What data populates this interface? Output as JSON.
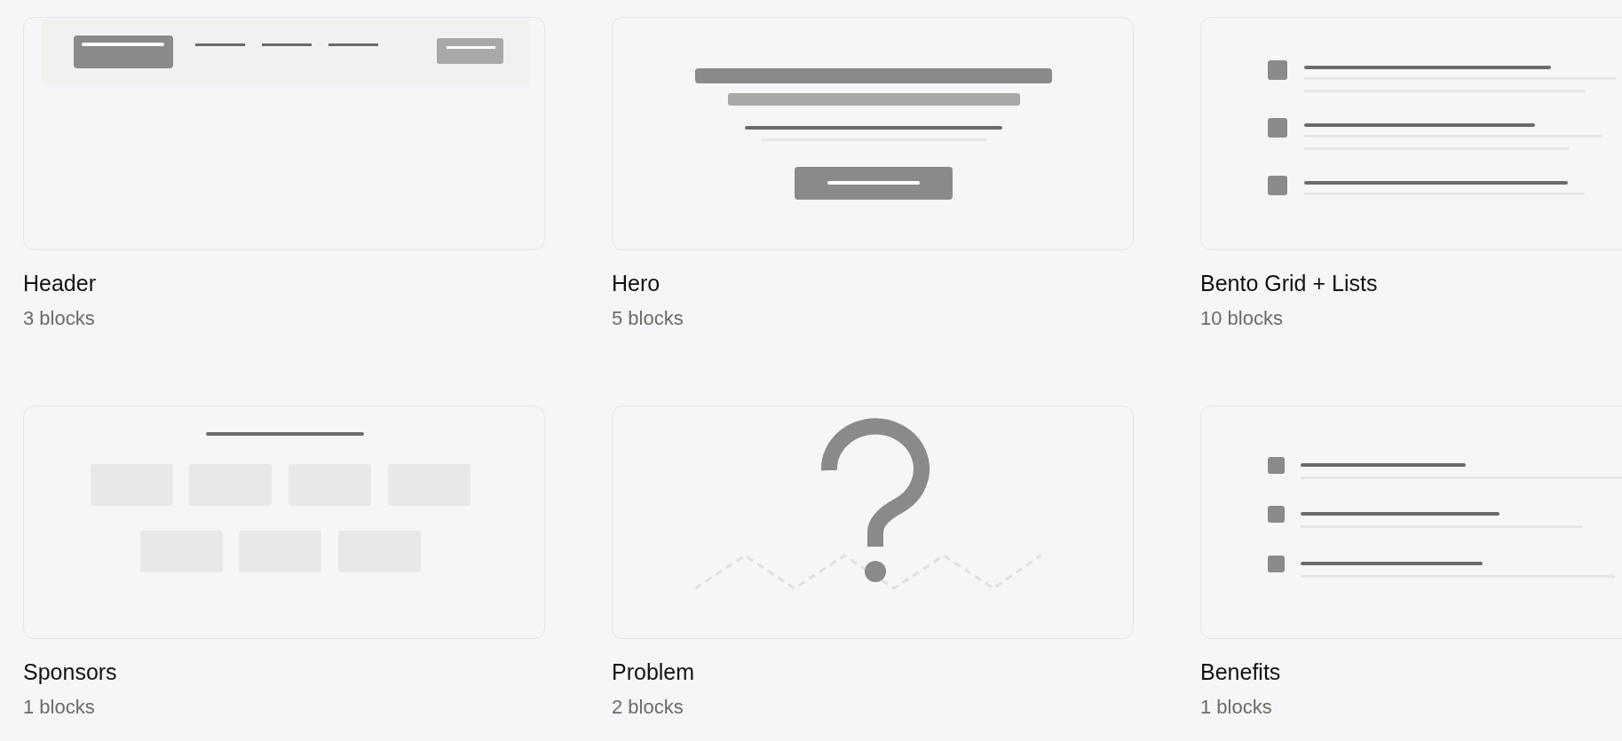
{
  "templates": [
    {
      "kind": "header",
      "title": "Header",
      "count": "3 blocks"
    },
    {
      "kind": "hero",
      "title": "Hero",
      "count": "5 blocks"
    },
    {
      "kind": "list",
      "title": "Bento Grid + Lists",
      "count": "10 blocks"
    },
    {
      "kind": "sponsors",
      "title": "Sponsors",
      "count": "1 blocks"
    },
    {
      "kind": "problem",
      "title": "Problem",
      "count": "2 blocks"
    },
    {
      "kind": "benefits",
      "title": "Benefits",
      "count": "1 blocks"
    }
  ]
}
